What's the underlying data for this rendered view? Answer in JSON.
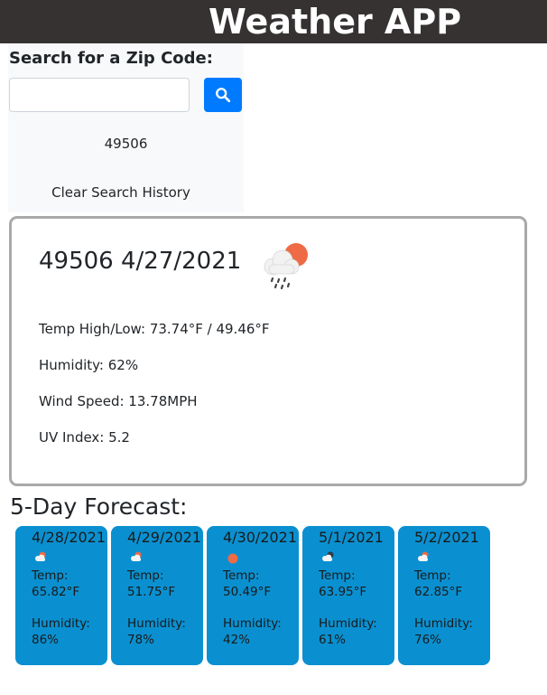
{
  "header": {
    "title": "Weather APP"
  },
  "search": {
    "label": "Search for a Zip Code:",
    "value": "",
    "placeholder": "",
    "button_icon": "search-icon",
    "history": [
      "49506"
    ],
    "clear_label": "Clear Search History"
  },
  "current": {
    "title": "49506 4/27/2021",
    "icon": "cloud-sun-rain-icon",
    "temp_label": "Temp High/Low: 73.74°F / 49.46°F",
    "humidity_label": "Humidity: 62%",
    "wind_label": "Wind Speed: 13.78MPH",
    "uv_label": "UV Index: 5.2"
  },
  "forecast": {
    "title": "5-Day Forecast:",
    "temp_label": "Temp:",
    "humidity_label": "Humidity:",
    "days": [
      {
        "date": "4/28/2021",
        "icon": "partly-cloudy-icon",
        "temp": "65.82°F",
        "humidity": "86%"
      },
      {
        "date": "4/29/2021",
        "icon": "partly-cloudy-icon",
        "temp": "51.75°F",
        "humidity": "78%"
      },
      {
        "date": "4/30/2021",
        "icon": "sun-icon",
        "temp": "50.49°F",
        "humidity": "42%"
      },
      {
        "date": "5/1/2021",
        "icon": "cloudy-night-icon",
        "temp": "63.95°F",
        "humidity": "61%"
      },
      {
        "date": "5/2/2021",
        "icon": "partly-cloudy-icon",
        "temp": "62.85°F",
        "humidity": "76%"
      }
    ]
  },
  "colors": {
    "header_bg": "#363232",
    "primary": "#007bff",
    "card_bg": "#0a90d0",
    "sun": "#ee6b46"
  }
}
